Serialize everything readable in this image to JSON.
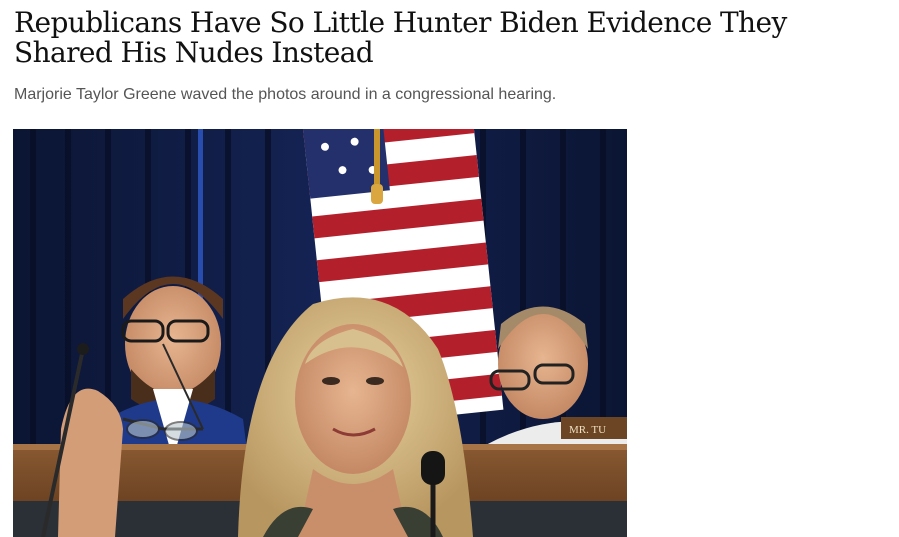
{
  "article": {
    "headline": "Republicans Have So Little Hunter Biden Evidence They Shared His Nudes Instead",
    "dek": "Marjorie Taylor Greene waved the photos around in a congressional hearing."
  },
  "hero_image": {
    "nameplate_text": "MR. TU"
  }
}
